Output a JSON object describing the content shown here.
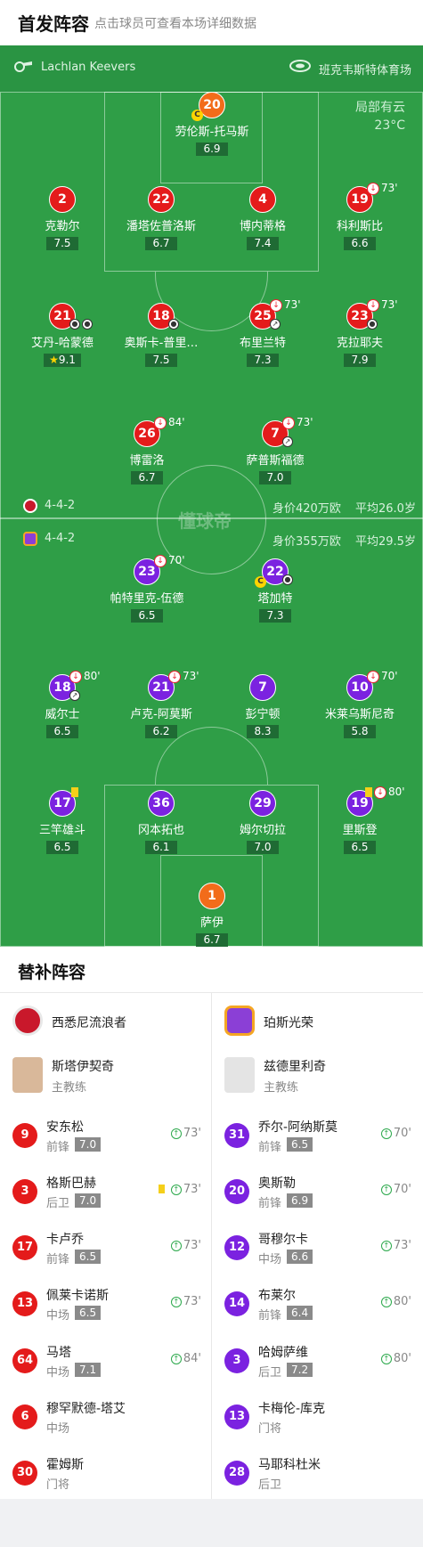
{
  "header": {
    "title": "首发阵容",
    "subtitle": "点击球员可查看本场详细数据"
  },
  "venue": {
    "referee": "Lachlan Keevers",
    "stadium": "班克韦斯特体育场",
    "weather": "局部有云",
    "temperature": "23°C"
  },
  "watermark": "懂球帝",
  "home_form": {
    "formation": "4-4-2",
    "value": "身价420万欧",
    "age": "平均26.0岁"
  },
  "away_form": {
    "formation": "4-4-2",
    "value": "身价355万欧",
    "age": "平均29.5岁"
  },
  "home_players": [
    {
      "num": "20",
      "name": "劳伦斯-托马斯",
      "rating": "6.9"
    },
    {
      "num": "2",
      "name": "克勒尔",
      "rating": "7.5"
    },
    {
      "num": "22",
      "name": "潘塔佐普洛斯",
      "rating": "6.7"
    },
    {
      "num": "4",
      "name": "博内蒂格",
      "rating": "7.4"
    },
    {
      "num": "19",
      "name": "科利斯比",
      "rating": "6.6",
      "sub": "73'"
    },
    {
      "num": "21",
      "name": "艾丹-哈蒙德",
      "rating": "9.1"
    },
    {
      "num": "18",
      "name": "奥斯卡-普里…",
      "rating": "7.5"
    },
    {
      "num": "25",
      "name": "布里兰特",
      "rating": "7.3",
      "sub": "73'"
    },
    {
      "num": "23",
      "name": "克拉耶夫",
      "rating": "7.9",
      "sub": "73'"
    },
    {
      "num": "26",
      "name": "博雷洛",
      "rating": "6.7",
      "sub": "84'"
    },
    {
      "num": "7",
      "name": "萨普斯福德",
      "rating": "7.0",
      "sub": "73'"
    }
  ],
  "away_players": [
    {
      "num": "23",
      "name": "帕特里克-伍德",
      "rating": "6.5",
      "sub": "70'"
    },
    {
      "num": "22",
      "name": "塔加特",
      "rating": "7.3"
    },
    {
      "num": "18",
      "name": "威尔士",
      "rating": "6.5",
      "sub": "80'"
    },
    {
      "num": "21",
      "name": "卢克-阿莫斯",
      "rating": "6.2",
      "sub": "73'"
    },
    {
      "num": "7",
      "name": "彭宁顿",
      "rating": "8.3"
    },
    {
      "num": "10",
      "name": "米莱乌斯尼奇",
      "rating": "5.8",
      "sub": "70'"
    },
    {
      "num": "17",
      "name": "三竿雄斗",
      "rating": "6.5"
    },
    {
      "num": "36",
      "name": "冈本拓也",
      "rating": "6.1"
    },
    {
      "num": "29",
      "name": "姆尔切拉",
      "rating": "7.0"
    },
    {
      "num": "19",
      "name": "里斯登",
      "rating": "6.5",
      "sub": "80'"
    },
    {
      "num": "1",
      "name": "萨伊",
      "rating": "6.7"
    }
  ],
  "subs": {
    "title": "替补阵容",
    "home": {
      "team": "西悉尼流浪者",
      "coach": {
        "name": "斯塔伊契奇",
        "role": "主教练"
      },
      "players": [
        {
          "num": "9",
          "name": "安东松",
          "pos": "前锋",
          "rating": "7.0",
          "min": "73'"
        },
        {
          "num": "3",
          "name": "格斯巴赫",
          "pos": "后卫",
          "rating": "7.0",
          "min": "73'"
        },
        {
          "num": "17",
          "name": "卡卢乔",
          "pos": "前锋",
          "rating": "6.5",
          "min": "73'"
        },
        {
          "num": "13",
          "name": "佩莱卡诺斯",
          "pos": "中场",
          "rating": "6.5",
          "min": "73'"
        },
        {
          "num": "64",
          "name": "马塔",
          "pos": "中场",
          "rating": "7.1",
          "min": "84'"
        },
        {
          "num": "6",
          "name": "穆罕默德-塔艾",
          "pos": "中场",
          "rating": "",
          "min": ""
        },
        {
          "num": "30",
          "name": "霍姆斯",
          "pos": "门将",
          "rating": "",
          "min": ""
        }
      ]
    },
    "away": {
      "team": "珀斯光荣",
      "coach": {
        "name": "兹德里利奇",
        "role": "主教练"
      },
      "players": [
        {
          "num": "31",
          "name": "乔尔-阿纳斯莫",
          "pos": "前锋",
          "rating": "6.5",
          "min": "70'"
        },
        {
          "num": "20",
          "name": "奥斯勒",
          "pos": "前锋",
          "rating": "6.9",
          "min": "70'"
        },
        {
          "num": "12",
          "name": "哥穆尔卡",
          "pos": "中场",
          "rating": "6.6",
          "min": "73'"
        },
        {
          "num": "14",
          "name": "布莱尔",
          "pos": "前锋",
          "rating": "6.4",
          "min": "80'"
        },
        {
          "num": "3",
          "name": "哈姆萨维",
          "pos": "后卫",
          "rating": "7.2",
          "min": "80'"
        },
        {
          "num": "13",
          "name": "卡梅伦-库克",
          "pos": "门将",
          "rating": "",
          "min": ""
        },
        {
          "num": "28",
          "name": "马耶科杜米",
          "pos": "后卫",
          "rating": "",
          "min": ""
        }
      ]
    }
  },
  "colors": {
    "pitch": "#2f9e47",
    "home": "#e41b1b",
    "home_gk": "#f26c1a",
    "away": "#7b22e0",
    "away_sub_bench": "#7b22e0"
  },
  "icons": [
    "whistle-icon",
    "stadium-icon",
    "captain-icon",
    "goal-ball-icon",
    "sub-off-icon",
    "yellow-card-icon",
    "sub-on-icon",
    "star-icon"
  ]
}
